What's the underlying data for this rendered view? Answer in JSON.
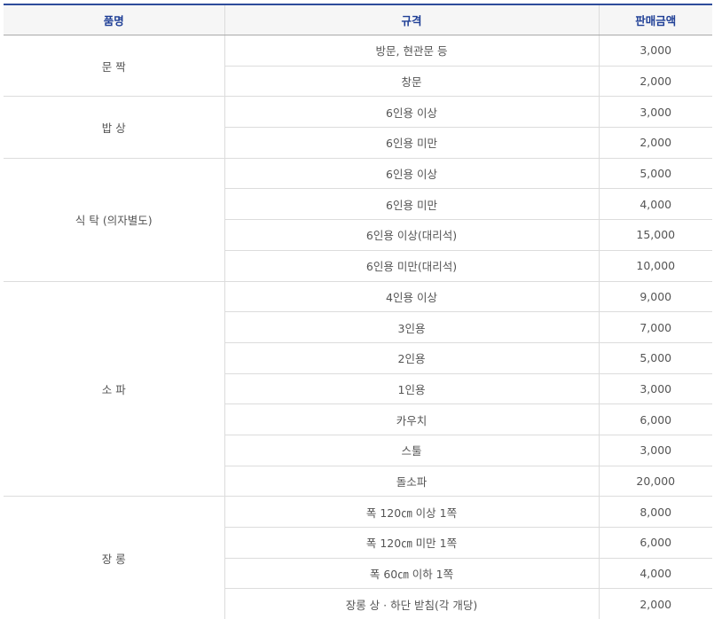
{
  "header": {
    "item": "품명",
    "spec": "규격",
    "price": "판매금액"
  },
  "groups": [
    {
      "name": "문 짝",
      "rows": [
        {
          "spec": "방문, 현관문 등",
          "price": "3,000"
        },
        {
          "spec": "창문",
          "price": "2,000"
        }
      ]
    },
    {
      "name": "밥 상",
      "rows": [
        {
          "spec": "6인용 이상",
          "price": "3,000"
        },
        {
          "spec": "6인용 미만",
          "price": "2,000"
        }
      ]
    },
    {
      "name": "식 탁 (의자별도)",
      "rows": [
        {
          "spec": "6인용 이상",
          "price": "5,000"
        },
        {
          "spec": "6인용 미만",
          "price": "4,000"
        },
        {
          "spec": "6인용 이상(대리석)",
          "price": "15,000"
        },
        {
          "spec": "6인용 미만(대리석)",
          "price": "10,000"
        }
      ]
    },
    {
      "name": "소 파",
      "rows": [
        {
          "spec": "4인용 이상",
          "price": "9,000"
        },
        {
          "spec": "3인용",
          "price": "7,000"
        },
        {
          "spec": "2인용",
          "price": "5,000"
        },
        {
          "spec": "1인용",
          "price": "3,000"
        },
        {
          "spec": "카우치",
          "price": "6,000"
        },
        {
          "spec": "스툴",
          "price": "3,000"
        },
        {
          "spec": "돌소파",
          "price": "20,000"
        }
      ]
    },
    {
      "name": "장 롱",
      "rows": [
        {
          "spec": "폭 120㎝ 이상 1쪽",
          "price": "8,000"
        },
        {
          "spec": "폭 120㎝ 미만 1쪽",
          "price": "6,000"
        },
        {
          "spec": "폭 60㎝ 이하 1쪽",
          "price": "4,000"
        },
        {
          "spec": "장롱 상 · 하단 받침(각 개당)",
          "price": "2,000"
        }
      ]
    }
  ]
}
